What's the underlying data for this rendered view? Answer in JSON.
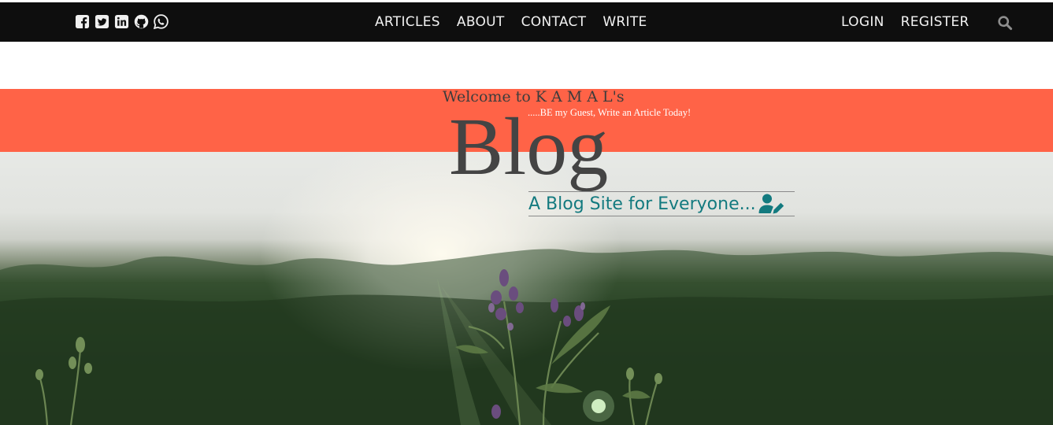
{
  "social": [
    {
      "icon": "facebook-square-icon"
    },
    {
      "icon": "twitter-square-icon"
    },
    {
      "icon": "linkedin-icon"
    },
    {
      "icon": "github-icon"
    },
    {
      "icon": "whatsapp-icon"
    }
  ],
  "nav": {
    "center": [
      "ARTICLES",
      "ABOUT",
      "CONTACT",
      "WRITE"
    ],
    "right": [
      "LOGIN",
      "REGISTER"
    ],
    "search_icon": "search-icon"
  },
  "hero": {
    "welcome": "Welcome to K A M A L's",
    "subtitle": ".....BE my Guest, Write an Article Today!",
    "title": "Blog",
    "tagline": "A Blog Site for Everyone...",
    "tagline_icon": "user-pen-icon",
    "band_color": "#ff6347",
    "tagline_color": "#137a7f"
  }
}
